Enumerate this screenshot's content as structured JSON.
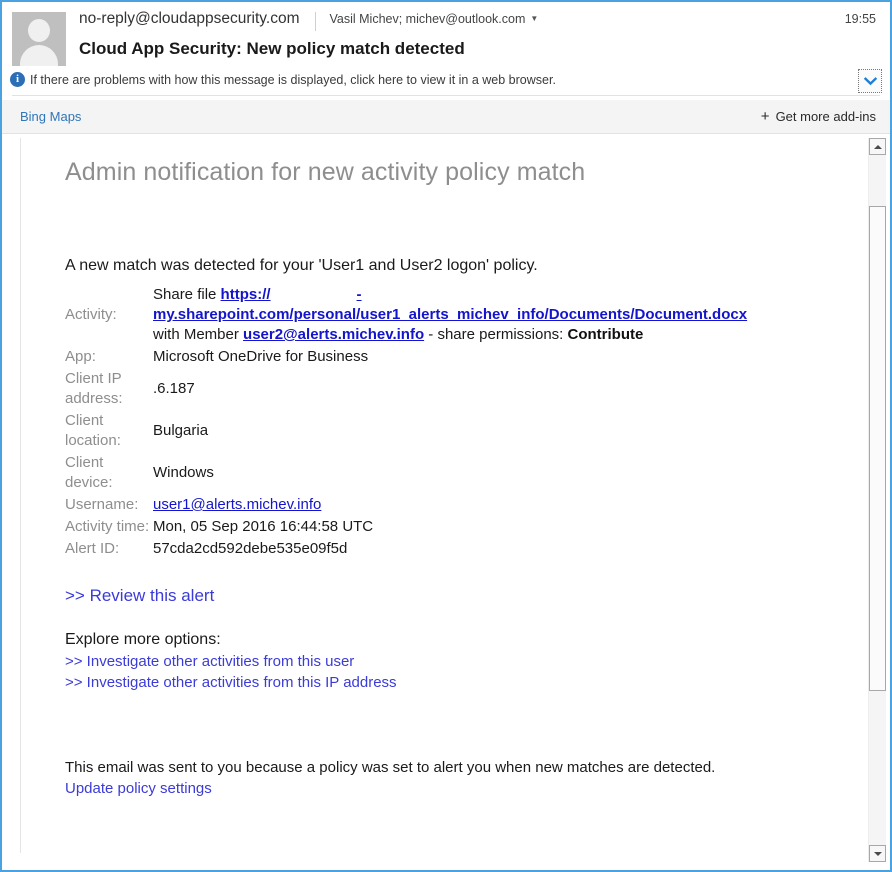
{
  "email_header": {
    "avatar_icon": "person-avatar-icon",
    "sender": "no-reply@cloudappsecurity.com",
    "recipients": "Vasil Michev; michev@outlook.com",
    "recipients_caret_icon": "chevron-down-icon",
    "time": "19:55",
    "subject": "Cloud App Security: New policy match detected"
  },
  "info_bar": {
    "icon": "info-icon",
    "icon_glyph": "i",
    "text": "If there are problems with how this message is displayed, click here to view it in a web browser.",
    "expand_button_icon": "chevron-down-icon"
  },
  "addin_bar": {
    "bing_maps_label": "Bing Maps",
    "plus_icon": "plus-icon",
    "get_more_label": "Get more add-ins"
  },
  "message": {
    "title": "Admin notification for new activity policy match",
    "lede": "A new match was detected for your 'User1 and User2 logon' policy.",
    "activity": {
      "label": "Activity:",
      "prefix": "Share file ",
      "url_scheme": "https://",
      "url_redacted_gap": "",
      "url_dash": "-",
      "url_rest": "my.sharepoint.com/personal/user1_alerts_michev_info/Documents/Document.docx",
      "member_prefix": "with Member ",
      "member_email": "user2@alerts.michev.info",
      "permissions_sep": " - share permissions: ",
      "permissions_value": "Contribute"
    },
    "rows": [
      {
        "label": "App:",
        "value": "Microsoft OneDrive for Business"
      },
      {
        "label": "Client IP address:",
        "value": ".6.187"
      },
      {
        "label": "Client location:",
        "value": "Bulgaria"
      },
      {
        "label": "Client device:",
        "value": "Windows"
      },
      {
        "label": "Username:",
        "value": "user1@alerts.michev.info"
      },
      {
        "label": "Activity time:",
        "value": "Mon, 05 Sep 2016 16:44:58 UTC"
      },
      {
        "label": "Alert ID:",
        "value": "57cda2cd592debe535e09f5d"
      }
    ],
    "review_link": ">> Review this alert",
    "explore_heading": "Explore more options:",
    "explore_links": [
      ">> Investigate other activities from this user",
      ">> Investigate other activities from this IP address"
    ],
    "footer_note": "This email was sent to you because a policy was set to alert you when new matches are detected.",
    "footer_link": "Update policy settings"
  },
  "scrollbar": {
    "up_icon": "triangle-up-icon",
    "down_icon": "triangle-down-icon",
    "thumb": "scrollbar-thumb"
  },
  "colors": {
    "window_border": "#4aa3e0",
    "link_blue": "#1414cc",
    "accent_blue": "#3b3bd8",
    "addin_link": "#2f76b8",
    "label_gray": "#8e8e8e"
  }
}
